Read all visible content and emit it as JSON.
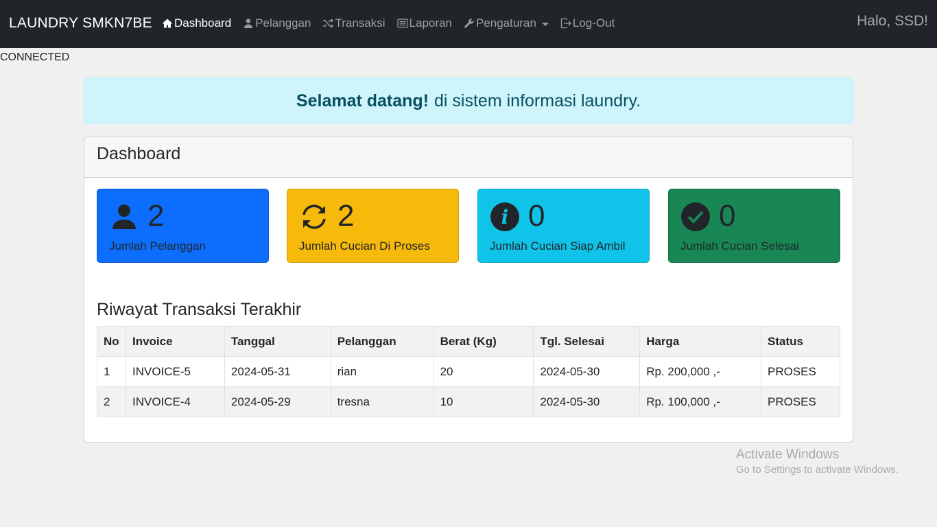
{
  "navbar": {
    "brand": "LAUNDRY SMKN7BE",
    "items": [
      {
        "label": "Dashboard",
        "icon": "home-icon"
      },
      {
        "label": "Pelanggan",
        "icon": "person-icon"
      },
      {
        "label": "Transaksi",
        "icon": "shuffle-icon"
      },
      {
        "label": "Laporan",
        "icon": "list-icon"
      },
      {
        "label": "Pengaturan",
        "icon": "wrench-icon"
      },
      {
        "label": "Log-Out",
        "icon": "logout-icon"
      }
    ],
    "greeting": "Halo, SSD!"
  },
  "status": "CONNECTED",
  "alert": {
    "bold": "Selamat datang!",
    "text": "di sistem informasi laundry."
  },
  "dashboard": {
    "title": "Dashboard",
    "tiles": [
      {
        "value": "2",
        "label": "Jumlah Pelanggan",
        "icon": "person-icon",
        "color": "#0d6efd"
      },
      {
        "value": "2",
        "label": "Jumlah Cucian Di Proses",
        "icon": "refresh-icon",
        "color": "#f7b90a"
      },
      {
        "value": "0",
        "label": "Jumlah Cucian Siap Ambil",
        "icon": "info-icon",
        "color": "#10c3e9"
      },
      {
        "value": "0",
        "label": "Jumlah Cucian Selesai",
        "icon": "check-circle-icon",
        "color": "#198754"
      }
    ]
  },
  "history": {
    "title": "Riwayat Transaksi Terakhir",
    "columns": [
      "No",
      "Invoice",
      "Tanggal",
      "Pelanggan",
      "Berat (Kg)",
      "Tgl. Selesai",
      "Harga",
      "Status"
    ],
    "rows": [
      [
        "1",
        "INVOICE-5",
        "2024-05-31",
        "rian",
        "20",
        "2024-05-30",
        "Rp. 200,000 ,-",
        "PROSES"
      ],
      [
        "2",
        "INVOICE-4",
        "2024-05-29",
        "tresna",
        "10",
        "2024-05-30",
        "Rp. 100,000 ,-",
        "PROSES"
      ]
    ]
  },
  "watermark": {
    "line1": "Activate Windows",
    "line2": "Go to Settings to activate Windows."
  }
}
